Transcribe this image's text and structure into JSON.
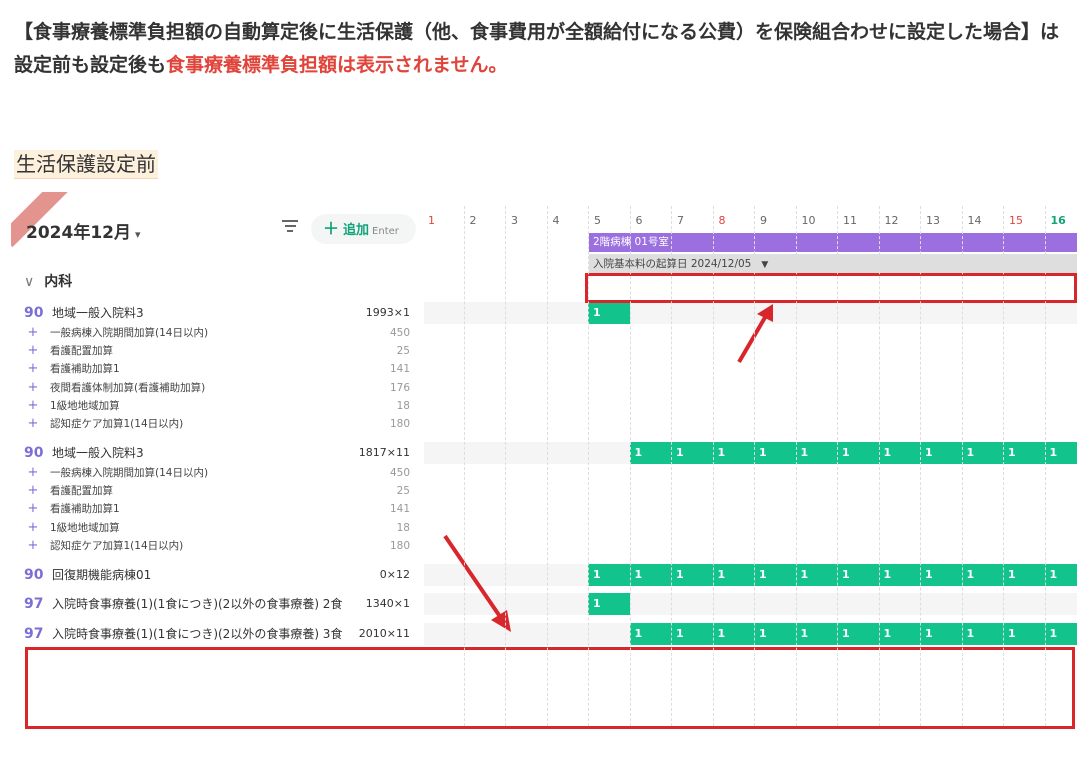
{
  "heading": {
    "part1": "【食事療養標準負担額の自動算定後に生活保護（他、食事費用が全額給付になる公費）を保険組合わせに設定した場合】は設定前も設定後も",
    "part2": "食事療養標準負担額は表示されません。"
  },
  "section_title": "生活保護設定前",
  "toolbar": {
    "month_label": "2024年12月",
    "add_label": "追加",
    "add_hint": "Enter"
  },
  "department": "内科",
  "calendar": {
    "days": [
      "1",
      "2",
      "3",
      "4",
      "5",
      "6",
      "7",
      "8",
      "9",
      "10",
      "11",
      "12",
      "13",
      "14",
      "15",
      "16"
    ],
    "red_days": [
      "1",
      "8",
      "15"
    ],
    "today": "16",
    "room_bar": "2階病棟 01号室",
    "basis_bar": "入院基本料の起算日 2024/12/05"
  },
  "orders": [
    {
      "code": "90",
      "name": "地域一般入院料3",
      "points": "1993×1",
      "subs": [
        {
          "name": "一般病棟入院期間加算(14日以内)",
          "points": "450"
        },
        {
          "name": "看護配置加算",
          "points": "25"
        },
        {
          "name": "看護補助加算1",
          "points": "141"
        },
        {
          "name": "夜間看護体制加算(看護補助加算)",
          "points": "176"
        },
        {
          "name": "1級地地域加算",
          "points": "18"
        },
        {
          "name": "認知症ケア加算1(14日以内)",
          "points": "180"
        }
      ],
      "cells": [
        "1"
      ]
    },
    {
      "code": "90",
      "name": "地域一般入院料3",
      "points": "1817×11",
      "subs": [
        {
          "name": "一般病棟入院期間加算(14日以内)",
          "points": "450"
        },
        {
          "name": "看護配置加算",
          "points": "25"
        },
        {
          "name": "看護補助加算1",
          "points": "141"
        },
        {
          "name": "1級地地域加算",
          "points": "18"
        },
        {
          "name": "認知症ケア加算1(14日以内)",
          "points": "180"
        }
      ],
      "cells": [
        "1",
        "1",
        "1",
        "1",
        "1",
        "1",
        "1",
        "1",
        "1",
        "1",
        "1"
      ]
    },
    {
      "code": "90",
      "name": "回復期機能病棟01",
      "points": "0×12",
      "subs": [],
      "cells": [
        "1",
        "1",
        "1",
        "1",
        "1",
        "1",
        "1",
        "1",
        "1",
        "1",
        "1",
        "1"
      ]
    },
    {
      "code": "97",
      "name": "入院時食事療養(1)(1食につき)(2以外の食事療養) 2食",
      "points": "1340×1",
      "subs": [],
      "cells": [
        "1"
      ]
    },
    {
      "code": "97",
      "name": "入院時食事療養(1)(1食につき)(2以外の食事療養) 3食",
      "points": "2010×11",
      "subs": [],
      "cells": [
        "1",
        "1",
        "1",
        "1",
        "1",
        "1",
        "1",
        "1",
        "1",
        "1",
        "1"
      ]
    }
  ],
  "colors": {
    "accent_green": "#12c48b",
    "room_purple": "#9b6fe0",
    "highlight_red": "#d8262a",
    "code_purple": "#7b6fd6"
  }
}
